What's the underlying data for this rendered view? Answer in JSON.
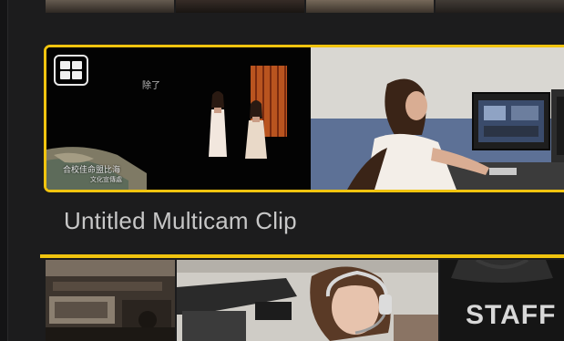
{
  "browser": {
    "selected_clip": {
      "title": "Untitled Multicam Clip",
      "badge_icon": "multicam-grid-icon",
      "angles": [
        {
          "caption_text": "除了",
          "subtitle_line1": "合校佳命盟比海",
          "subtitle_line2": "文化宣傳處"
        },
        {}
      ]
    },
    "bottom_row": {
      "thumbnails": [
        {},
        {},
        {
          "text": "STAFF"
        }
      ]
    }
  },
  "colors": {
    "selection": "#f1c40f",
    "background": "#1c1c1d",
    "title_text": "#c7c7c7"
  }
}
